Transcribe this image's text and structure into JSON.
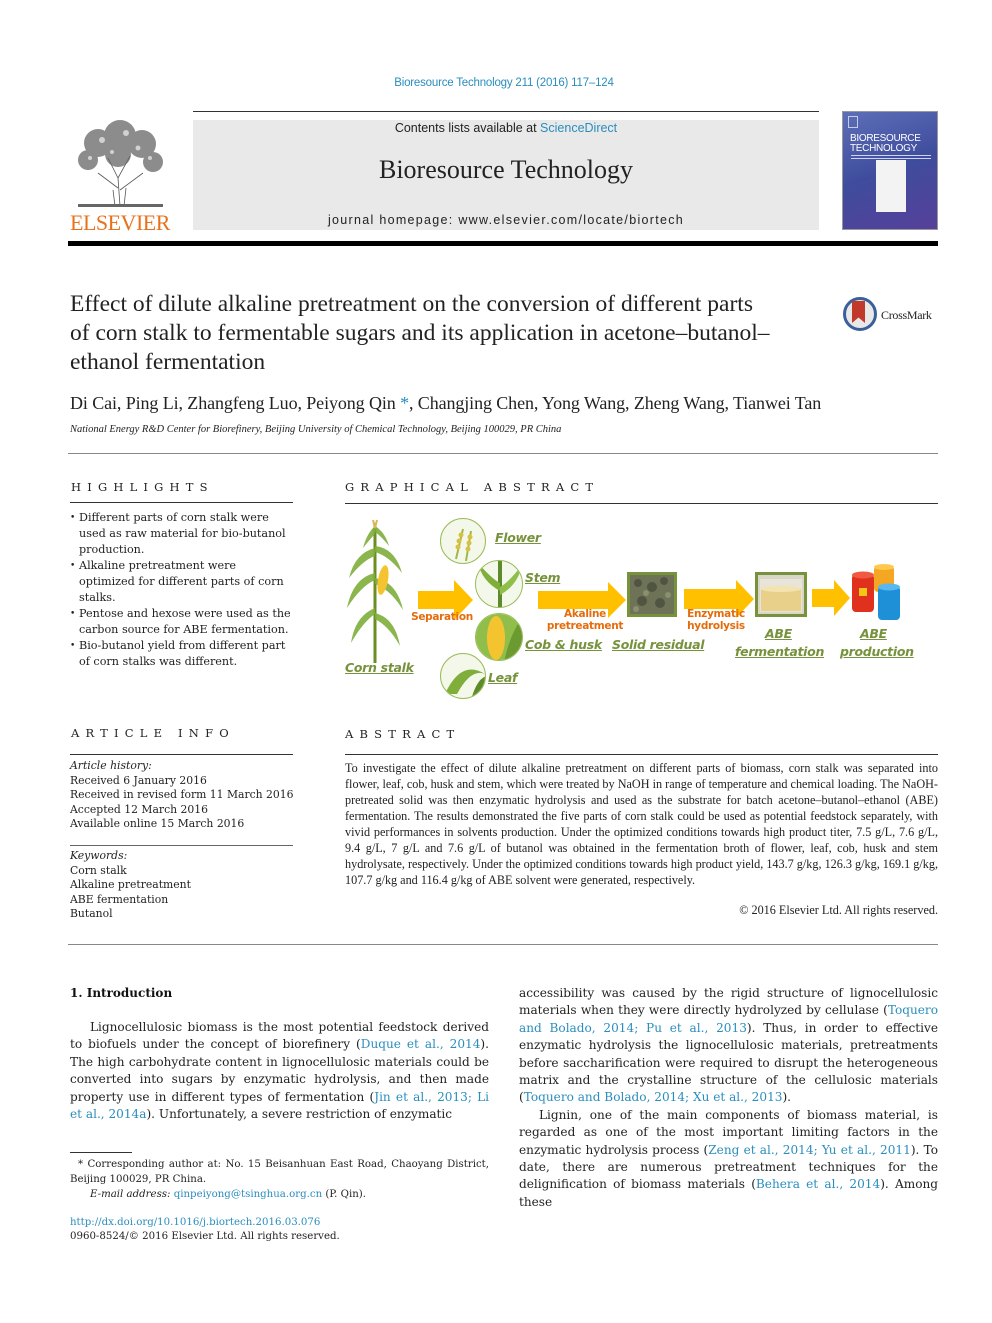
{
  "header": {
    "citation": "Bioresource Technology 211 (2016) 117–124",
    "contents_prefix": "Contents lists available at ",
    "contents_link": "ScienceDirect",
    "journal_name": "Bioresource Technology",
    "homepage": "journal homepage: www.elsevier.com/locate/biortech",
    "publisher_logo_text": "ELSEVIER",
    "cover_title_line1": "BIORESOURCE",
    "cover_title_line2": "TECHNOLOGY",
    "crossmark_label": "CrossMark"
  },
  "article": {
    "title": "Effect of dilute alkaline pretreatment on the conversion of different parts of corn stalk to fermentable sugars and its application in acetone–butanol–ethanol fermentation",
    "authors_before": "Di Cai, Ping Li, Zhangfeng Luo, Peiyong Qin",
    "author_mark": "*",
    "authors_after": ", Changjing Chen, Yong Wang, Zheng Wang, Tianwei Tan",
    "affiliation": "National Energy R&D Center for Biorefinery, Beijing University of Chemical Technology, Beijing 100029, PR China"
  },
  "highlights": {
    "heading": "HIGHLIGHTS",
    "items": [
      "Different parts of corn stalk were used as raw material for bio-butanol production.",
      "Alkaline pretreatment were optimized for different parts of corn stalks.",
      "Pentose and hexose were used as the carbon source for ABE fermentation.",
      "Bio-butanol yield from different part of corn stalks was different."
    ]
  },
  "graphical_abstract": {
    "heading": "GRAPHICAL ABSTRACT",
    "labels": {
      "corn_stalk": "Corn stalk",
      "flower": "Flower",
      "stem": "Stem",
      "cob_husk": "Cob & husk",
      "leaf": "Leaf",
      "solid_residual": "Solid residual",
      "abe_fermentation_1": "ABE",
      "abe_fermentation_2": "fermentation",
      "abe_production_1": "ABE",
      "abe_production_2": "production"
    },
    "steps": {
      "separation": "Separation",
      "pretreatment_1": "Akaline",
      "pretreatment_2": "pretreatment",
      "hydrolysis_1": "Enzymatic",
      "hydrolysis_2": "hydrolysis"
    },
    "colors": {
      "arrow": "#ffc000",
      "step_text": "#e46c0a",
      "label_text": "#76923c"
    }
  },
  "article_info": {
    "heading": "ARTICLE INFO",
    "history_label": "Article history:",
    "history": [
      "Received 6 January 2016",
      "Received in revised form 11 March 2016",
      "Accepted 12 March 2016",
      "Available online 15 March 2016"
    ],
    "keywords_label": "Keywords:",
    "keywords": [
      "Corn stalk",
      "Alkaline pretreatment",
      "ABE fermentation",
      "Butanol"
    ]
  },
  "abstract": {
    "heading": "ABSTRACT",
    "text": "To investigate the effect of dilute alkaline pretreatment on different parts of biomass, corn stalk was separated into flower, leaf, cob, husk and stem, which were treated by NaOH in range of temperature and chemical loading. The NaOH-pretreated solid was then enzymatic hydrolysis and used as the substrate for batch acetone–butanol–ethanol (ABE) fermentation. The results demonstrated the five parts of corn stalk could be used as potential feedstock separately, with vivid performances in solvents production. Under the optimized conditions towards high product titer, 7.5 g/L, 7.6 g/L, 9.4 g/L, 7 g/L and 7.6 g/L of butanol was obtained in the fermentation broth of flower, leaf, cob, husk and stem hydrolysate, respectively. Under the optimized conditions towards high product yield, 143.7 g/kg, 126.3 g/kg, 169.1 g/kg, 107.7 g/kg and 116.4 g/kg of ABE solvent were generated, respectively.",
    "copyright": "© 2016 Elsevier Ltd. All rights reserved."
  },
  "introduction": {
    "heading": "1. Introduction",
    "p1": [
      {
        "t": "Lignocellulosic biomass is the most potential feedstock derived to biofuels under the concept of biorefinery ("
      },
      {
        "t": "Duque et al., 2014",
        "link": true
      },
      {
        "t": "). The high carbohydrate content in lignocellulosic materials could be converted into sugars by enzymatic hydrolysis, and then made property use in different types of fermentation ("
      },
      {
        "t": "Jin et al., 2013; Li et al., 2014a",
        "link": true
      },
      {
        "t": "). Unfortunately, a severe restriction of enzymatic accessibility was caused by the rigid structure of lignocellulosic materials when they were directly hydrolyzed by cellulase ("
      },
      {
        "t": "Toquero and Bolado, 2014; Pu et al., 2013",
        "link": true
      },
      {
        "t": "). Thus, in order to effective enzymatic hydrolysis the lignocellulosic materials, pretreatments before saccharification were required to disrupt the heterogeneous matrix and the crystalline structure of the cellulosic materials ("
      },
      {
        "t": "Toquero and Bolado, 2014; Xu et al., 2013",
        "link": true
      },
      {
        "t": ")."
      }
    ],
    "p1_left": "Lignocellulosic biomass is the most potential feedstock derived to biofuels under the concept of biorefinery (",
    "cite_duque": "Duque et al., 2014",
    "p1_left_b": "). The high carbohydrate content in lignocellulosic materials could be converted into sugars by enzymatic hydrolysis, and then made property use in different types of fermentation (",
    "cite_jin": "Jin et al., 2013; Li et al., 2014a",
    "p1_left_c": "). Unfortunately, a severe restriction of enzymatic",
    "p1_right_a": "accessibility was caused by the rigid structure of lignocellulosic materials when they were directly hydrolyzed by cellulase (",
    "cite_toquero_pu": "Toquero and Bolado, 2014; Pu et al., 2013",
    "p1_right_b": "). Thus, in order to effective enzymatic hydrolysis the lignocellulosic materials, pretreatments before saccharification were required to disrupt the heterogeneous matrix and the crystalline structure of the cellulosic materials (",
    "cite_toquero_xu": "Toquero and Bolado, 2014; Xu et al., 2013",
    "p1_right_c": ").",
    "p2_a": "Lignin, one of the main components of biomass material, is regarded as one of the most important limiting factors in the enzymatic hydrolysis process (",
    "cite_zeng_yu": "Zeng et al., 2014; Yu et al., 2011",
    "p2_b": "). To date, there are numerous pretreatment techniques for the delignification of biomass materials (",
    "cite_behera": "Behera et al., 2014",
    "p2_c": "). Among these"
  },
  "footnote": {
    "corresponding": "* Corresponding author at: No. 15 Beisanhuan East Road, Chaoyang District, Beijing 100029, PR China.",
    "email_label": "E-mail address: ",
    "email": "qinpeiyong@tsinghua.org.cn",
    "email_suffix": " (P. Qin).",
    "doi": "http://dx.doi.org/10.1016/j.biortech.2016.03.076",
    "issn": "0960-8524/© 2016 Elsevier Ltd. All rights reserved."
  }
}
